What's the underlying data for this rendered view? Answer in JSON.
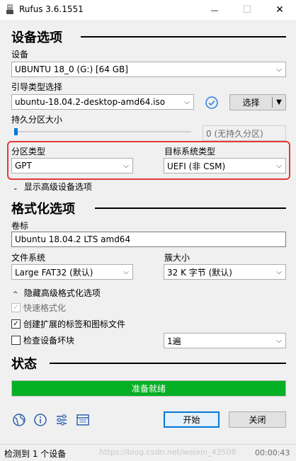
{
  "window": {
    "title": "Rufus 3.6.1551",
    "minimize_glyph": "—",
    "maximize_glyph": "☐",
    "close_glyph": "✕"
  },
  "device_section": {
    "heading": "设备选项",
    "device_label": "设备",
    "device_value": "UBUNTU 18_0 (G:) [64 GB]",
    "boot_label": "引导类型选择",
    "boot_value": "ubuntu-18.04.2-desktop-amd64.iso",
    "select_button": "选择",
    "persist_label": "持久分区大小",
    "persist_value": "0 (无持久分区)",
    "persist_level": 0,
    "partition_label": "分区类型",
    "partition_value": "GPT",
    "target_label": "目标系统类型",
    "target_value": "UEFI (非 CSM)",
    "advanced_toggle": "显示高级设备选项"
  },
  "format_section": {
    "heading": "格式化选项",
    "volume_label": "卷标",
    "volume_value": "Ubuntu 18.04.2 LTS amd64",
    "fs_label": "文件系统",
    "fs_value": "Large FAT32 (默认)",
    "cluster_label": "簇大小",
    "cluster_value": "32 K 字节 (默认)",
    "advanced_toggle": "隐藏高级格式化选项",
    "quick_format": {
      "label": "快速格式化",
      "checked": true,
      "enabled": false
    },
    "extended_label": {
      "label": "创建扩展的标签和图标文件",
      "checked": true
    },
    "bad_blocks": {
      "label": "检查设备坏块",
      "checked": false
    },
    "passes_value": "1遍"
  },
  "status_section": {
    "heading": "状态",
    "progress_text": "准备就绪",
    "progress_level": 1.0
  },
  "actions": {
    "start_button": "开始",
    "close_button": "关闭"
  },
  "statusbar": {
    "message": "检测到 1 个设备",
    "watermark": "https://blog.csdn.net/weixin_43508",
    "timer": "00:00:43"
  },
  "glyphs": {
    "chevron": "⌵",
    "check": "✓",
    "collapsed": "⌄",
    "expanded": "^"
  },
  "colors": {
    "progress": "#06b025",
    "highlight_box": "#e53935",
    "accent": "#0078d7"
  }
}
